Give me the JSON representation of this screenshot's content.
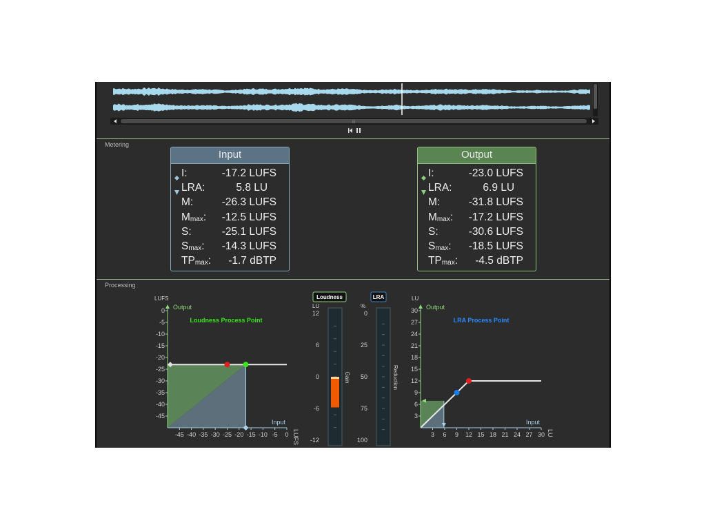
{
  "colors": {
    "background": "#2c2c2c",
    "waveform": "#a8d8ec",
    "divider": "#9fc48e",
    "input_accent": "#5b7384",
    "output_accent": "#5a8452",
    "loudness_title": "#39e61c",
    "lra_title": "#2a8aff",
    "gain_bar": "#f05a00",
    "process_point_red": "#e02020",
    "process_point_green": "#39e61c",
    "process_point_blue": "#1a7de6"
  },
  "transport": {
    "skip_back_icon": "skip-to-start-icon",
    "pause_icon": "pause-icon",
    "scroll_left_icon": "arrow-left-icon",
    "scroll_right_icon": "arrow-right-icon",
    "scroll_grip_label": "III"
  },
  "metering": {
    "section_label": "Metering",
    "input": {
      "title": "Input",
      "rows": [
        {
          "label": "I:",
          "sub": "",
          "value": "-17.2 LUFS",
          "marker": "diamond"
        },
        {
          "label": "LRA:",
          "sub": "",
          "value": "5.8 LU   ",
          "marker": "drop"
        },
        {
          "label": "M:",
          "sub": "",
          "value": "-26.3 LUFS",
          "marker": ""
        },
        {
          "label": "M",
          "sub": "max",
          "value": "-12.5 LUFS",
          "marker": ""
        },
        {
          "label": "S:",
          "sub": "",
          "value": "-25.1 LUFS",
          "marker": ""
        },
        {
          "label": "S",
          "sub": "max",
          "value": "-14.3 LUFS",
          "marker": ""
        },
        {
          "label": "TP",
          "sub": "max",
          "value": "-1.7 dBTP",
          "marker": ""
        }
      ]
    },
    "output": {
      "title": "Output",
      "rows": [
        {
          "label": "I:",
          "sub": "",
          "value": "-23.0 LUFS",
          "marker": "diamond"
        },
        {
          "label": "LRA:",
          "sub": "",
          "value": "6.9 LU   ",
          "marker": "drop"
        },
        {
          "label": "M:",
          "sub": "",
          "value": "-31.8 LUFS",
          "marker": ""
        },
        {
          "label": "M",
          "sub": "max",
          "value": "-17.2 LUFS",
          "marker": ""
        },
        {
          "label": "S:",
          "sub": "",
          "value": "-30.6 LUFS",
          "marker": ""
        },
        {
          "label": "S",
          "sub": "max",
          "value": "-18.5 LUFS",
          "marker": ""
        },
        {
          "label": "TP",
          "sub": "max",
          "value": "-4.5 dBTP",
          "marker": ""
        }
      ]
    }
  },
  "processing": {
    "section_label": "Processing",
    "loudness_chart": {
      "unit_label": "LUFS",
      "y_axis_title": "Output",
      "x_axis_title": "Input",
      "x_unit_label": "LUFS",
      "chart_title": "Loudness Process Point",
      "y_ticks": [
        "0",
        "-5",
        "-10",
        "-15",
        "-20",
        "-25",
        "-30",
        "-35",
        "-40",
        "-45"
      ],
      "x_ticks": [
        "-45",
        "-40",
        "-35",
        "-30",
        "-25",
        "-20",
        "-15",
        "-10",
        "-5",
        "0"
      ],
      "y_min": -50,
      "y_max": 0,
      "x_min": -50,
      "x_max": 0,
      "target_output": -23,
      "process_point_input": -25,
      "current_input": -17.2
    },
    "gain_meter": {
      "button_label": "Loudness",
      "unit": "LU",
      "ticks": [
        "12",
        "6",
        "0",
        "-6",
        "-12"
      ],
      "caption": "Gain",
      "min": -12,
      "max": 12,
      "value": -5.8
    },
    "lra_meter": {
      "button_label": "LRA",
      "unit": "%",
      "ticks": [
        "0",
        "25",
        "50",
        "75",
        "100"
      ],
      "caption": "Reduction",
      "min": 0,
      "max": 100,
      "value": 0
    },
    "lra_chart": {
      "unit_label": "LU",
      "y_axis_title": "Output",
      "x_axis_title": "Input",
      "x_unit_label": "LU",
      "chart_title": "LRA Process Point",
      "y_ticks": [
        "30",
        "27",
        "24",
        "21",
        "18",
        "15",
        "12",
        "9",
        "6",
        "3"
      ],
      "x_ticks": [
        "3",
        "6",
        "9",
        "12",
        "15",
        "18",
        "21",
        "24",
        "27",
        "30"
      ],
      "y_min": 0,
      "y_max": 30,
      "x_min": 0,
      "x_max": 30,
      "knee_input": 12,
      "current_input": 5.8,
      "current_output": 6.9,
      "blue_point_input": 9
    }
  }
}
